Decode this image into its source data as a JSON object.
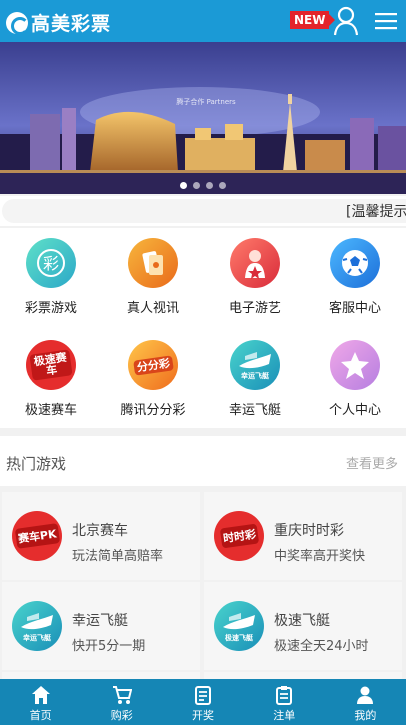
{
  "header": {
    "logo_text": "高美彩票",
    "new_badge": "NEW",
    "icons": [
      "logo-icon",
      "user-icon",
      "menu-icon"
    ]
  },
  "banner": {
    "watermark": "腾子合作 Partners",
    "slides": 4,
    "active_slide": 1
  },
  "notice": {
    "text": "[温馨提示"
  },
  "grid": [
    {
      "label": "彩票游戏",
      "icon": "lottery-icon",
      "color": "#3ec7c0"
    },
    {
      "label": "真人视讯",
      "icon": "card-icon",
      "color": "#f29a25"
    },
    {
      "label": "电子游艺",
      "icon": "game-icon",
      "color": "#ef4a4a"
    },
    {
      "label": "客服中心",
      "icon": "soccer-icon",
      "color": "#2b97e8"
    },
    {
      "label": "极速赛车",
      "icon": "racing-icon",
      "color": "#e52d2d",
      "badge": "极速赛车"
    },
    {
      "label": "腾讯分分彩",
      "icon": "tencent-icon",
      "color": "#f59a2a",
      "badge": "分分彩"
    },
    {
      "label": "幸运飞艇",
      "icon": "boat-icon",
      "color": "#2ab7b3",
      "badge": "幸运飞艇"
    },
    {
      "label": "个人中心",
      "icon": "star-icon",
      "color": "#d98ee0"
    }
  ],
  "hot": {
    "title": "热门游戏",
    "more": "查看更多",
    "cards": [
      {
        "title": "北京赛车",
        "subtitle": "玩法简单高赔率",
        "icon": "racing-icon",
        "badge": "赛车PK"
      },
      {
        "title": "重庆时时彩",
        "subtitle": "中奖率高开奖快",
        "icon": "shishicai-icon",
        "badge": "时时彩"
      },
      {
        "title": "幸运飞艇",
        "subtitle": "快开5分一期",
        "icon": "boat-icon",
        "badge": "幸运飞艇"
      },
      {
        "title": "极速飞艇",
        "subtitle": "极速全天24小时",
        "icon": "boat-icon",
        "badge": "极速飞艇"
      }
    ]
  },
  "nav": [
    {
      "label": "首页",
      "icon": "home-icon"
    },
    {
      "label": "购彩",
      "icon": "cart-icon"
    },
    {
      "label": "开奖",
      "icon": "document-icon"
    },
    {
      "label": "注单",
      "icon": "clipboard-icon"
    },
    {
      "label": "我的",
      "icon": "person-icon"
    }
  ]
}
